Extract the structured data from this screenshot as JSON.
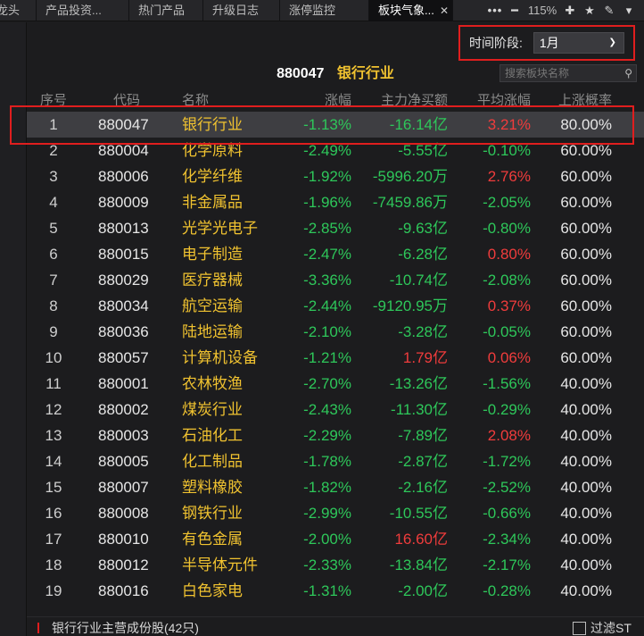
{
  "tabs": [
    {
      "label": "龙头"
    },
    {
      "label": "产品投资..."
    },
    {
      "label": "热门产品"
    },
    {
      "label": "升级日志"
    },
    {
      "label": "涨停监控"
    },
    {
      "label": "板块气象..."
    }
  ],
  "toolbar": {
    "zoom": "115%"
  },
  "period": {
    "label": "时间阶段:",
    "value": "1月"
  },
  "header": {
    "code": "880047",
    "name": "银行行业"
  },
  "search": {
    "placeholder": "搜索板块名称"
  },
  "columns": [
    "序号",
    "代码",
    "名称",
    "涨幅",
    "主力净买额",
    "平均涨幅",
    "上涨概率"
  ],
  "rows": [
    {
      "idx": "1",
      "code": "880047",
      "name": "银行行业",
      "chg": "-1.13%",
      "flow": "-16.14亿",
      "avg": "3.21%",
      "up": "80.00%"
    },
    {
      "idx": "2",
      "code": "880004",
      "name": "化学原料",
      "chg": "-2.49%",
      "flow": "-5.55亿",
      "avg": "-0.10%",
      "up": "60.00%"
    },
    {
      "idx": "3",
      "code": "880006",
      "name": "化学纤维",
      "chg": "-1.92%",
      "flow": "-5996.20万",
      "avg": "2.76%",
      "up": "60.00%"
    },
    {
      "idx": "4",
      "code": "880009",
      "name": "非金属品",
      "chg": "-1.96%",
      "flow": "-7459.86万",
      "avg": "-2.05%",
      "up": "60.00%"
    },
    {
      "idx": "5",
      "code": "880013",
      "name": "光学光电子",
      "chg": "-2.85%",
      "flow": "-9.63亿",
      "avg": "-0.80%",
      "up": "60.00%"
    },
    {
      "idx": "6",
      "code": "880015",
      "name": "电子制造",
      "chg": "-2.47%",
      "flow": "-6.28亿",
      "avg": "0.80%",
      "up": "60.00%"
    },
    {
      "idx": "7",
      "code": "880029",
      "name": "医疗器械",
      "chg": "-3.36%",
      "flow": "-10.74亿",
      "avg": "-2.08%",
      "up": "60.00%"
    },
    {
      "idx": "8",
      "code": "880034",
      "name": "航空运输",
      "chg": "-2.44%",
      "flow": "-9120.95万",
      "avg": "0.37%",
      "up": "60.00%"
    },
    {
      "idx": "9",
      "code": "880036",
      "name": "陆地运输",
      "chg": "-2.10%",
      "flow": "-3.28亿",
      "avg": "-0.05%",
      "up": "60.00%"
    },
    {
      "idx": "10",
      "code": "880057",
      "name": "计算机设备",
      "chg": "-1.21%",
      "flow": "1.79亿",
      "avg": "0.06%",
      "up": "60.00%"
    },
    {
      "idx": "11",
      "code": "880001",
      "name": "农林牧渔",
      "chg": "-2.70%",
      "flow": "-13.26亿",
      "avg": "-1.56%",
      "up": "40.00%"
    },
    {
      "idx": "12",
      "code": "880002",
      "name": "煤炭行业",
      "chg": "-2.43%",
      "flow": "-11.30亿",
      "avg": "-0.29%",
      "up": "40.00%"
    },
    {
      "idx": "13",
      "code": "880003",
      "name": "石油化工",
      "chg": "-2.29%",
      "flow": "-7.89亿",
      "avg": "2.08%",
      "up": "40.00%"
    },
    {
      "idx": "14",
      "code": "880005",
      "name": "化工制品",
      "chg": "-1.78%",
      "flow": "-2.87亿",
      "avg": "-1.72%",
      "up": "40.00%"
    },
    {
      "idx": "15",
      "code": "880007",
      "name": "塑料橡胶",
      "chg": "-1.82%",
      "flow": "-2.16亿",
      "avg": "-2.52%",
      "up": "40.00%"
    },
    {
      "idx": "16",
      "code": "880008",
      "name": "钢铁行业",
      "chg": "-2.99%",
      "flow": "-10.55亿",
      "avg": "-0.66%",
      "up": "40.00%"
    },
    {
      "idx": "17",
      "code": "880010",
      "name": "有色金属",
      "chg": "-2.00%",
      "flow": "16.60亿",
      "avg": "-2.34%",
      "up": "40.00%"
    },
    {
      "idx": "18",
      "code": "880012",
      "name": "半导体元件",
      "chg": "-2.33%",
      "flow": "-13.84亿",
      "avg": "-2.17%",
      "up": "40.00%"
    },
    {
      "idx": "19",
      "code": "880016",
      "name": "白色家电",
      "chg": "-1.31%",
      "flow": "-2.00亿",
      "avg": "-0.28%",
      "up": "40.00%"
    }
  ],
  "footer": {
    "label": "银行行业主营成份股(42只)",
    "filter": "过滤ST"
  },
  "colors": {
    "up": "#f03c3c",
    "down": "#2ec75a",
    "name": "#f0c230",
    "highlight_border": "#e01e1e"
  }
}
